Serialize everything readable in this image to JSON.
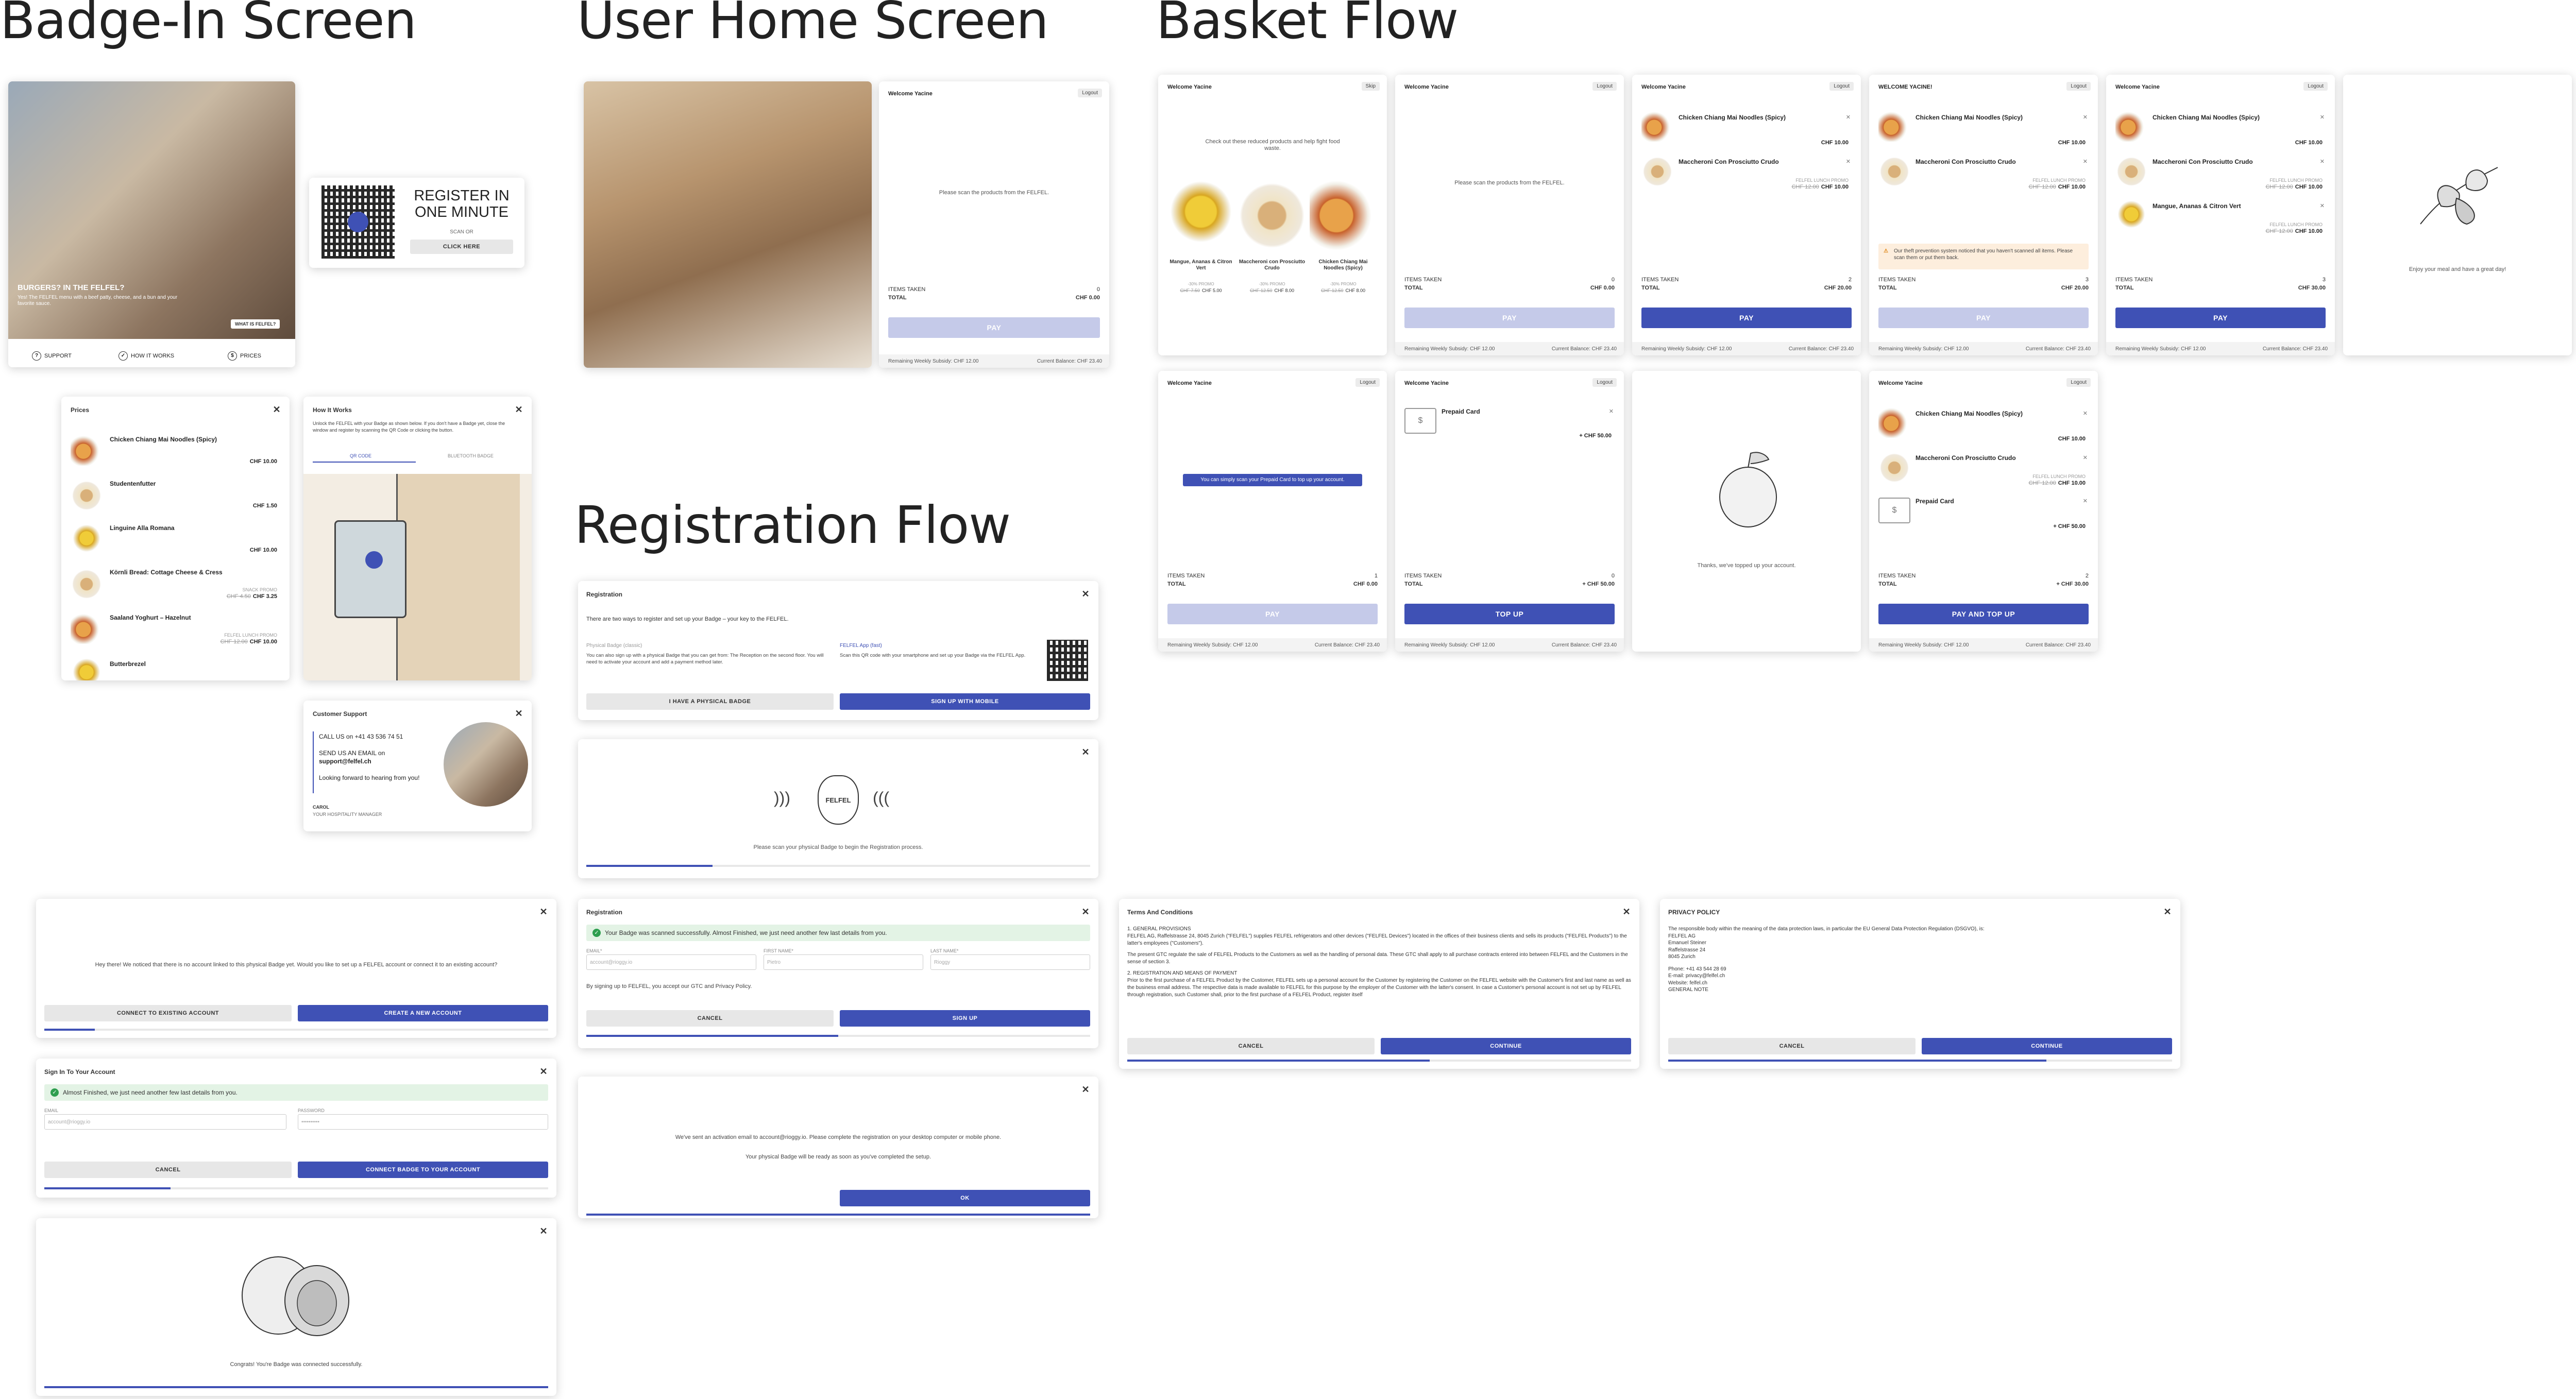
{
  "sections": {
    "badge_in": "Badge-In Screen",
    "user_home": "User Home Screen",
    "basket": "Basket Flow",
    "registration": "Registration Flow"
  },
  "badge_home": {
    "headline": "BURGERS? IN THE FELFEL?",
    "subline": "Yes! The FELFEL menu with a beef patty, cheese, and a bun and your favorite sauce.",
    "what_is": "WHAT IS FELFEL?",
    "nav": [
      "SUPPORT",
      "HOW IT WORKS",
      "PRICES"
    ]
  },
  "register_card": {
    "title": "REGISTER IN ONE MINUTE",
    "scan_or": "SCAN OR",
    "click_here": "CLICK HERE"
  },
  "prices": {
    "title": "Prices",
    "items": [
      {
        "name": "Chicken Chiang Mai Noodles (Spicy)",
        "price": "CHF 10.00"
      },
      {
        "name": "Studentenfutter",
        "price": "CHF 1.50"
      },
      {
        "name": "Linguine Alla Romana",
        "price": "CHF 10.00"
      },
      {
        "name": "Körnli Bread: Cottage Cheese & Cress",
        "promo": "SNACK PROMO",
        "old": "CHF 4.50",
        "price": "CHF 3.25"
      },
      {
        "name": "Saaland Yoghurt – Hazelnut",
        "promo": "FELFEL LUNCH PROMO",
        "old": "CHF 12.00",
        "price": "CHF 10.00"
      },
      {
        "name": "Butterbrezel"
      }
    ]
  },
  "how": {
    "title": "How It Works",
    "text": "Unlock the FELFEL with your Badge as shown below. If you don't have a Badge yet, close the window and register by scanning the QR Code or clicking the button.",
    "tabs": [
      "QR CODE",
      "BLUETOOTH BADGE"
    ]
  },
  "support": {
    "title": "Customer Support",
    "call": "CALL US on +41 43 536 74 51",
    "email_pre": "SEND US AN EMAIL on",
    "email": "support@felfel.ch",
    "note": "Looking forward to hearing from you!",
    "name": "CAROL",
    "role": "YOUR HOSPITALITY MANAGER"
  },
  "user_home": {
    "welcome": "Welcome Yacine",
    "logout": "Logout",
    "scan": "Please scan the products from the FELFEL.",
    "items_taken": "ITEMS TAKEN",
    "items_val": "0",
    "total": "TOTAL",
    "total_val": "CHF 0.00",
    "pay": "PAY",
    "subsidy": "Remaining Weekly Subsidy: CHF 12.00",
    "balance": "Current Balance: CHF 23.40"
  },
  "basket": {
    "b1": {
      "welcome": "Welcome Yacine",
      "skip": "Skip",
      "text": "Check out these reduced products and help fight food waste.",
      "products": [
        {
          "name": "Mangue, Ananas & Citron Vert",
          "tag": "-30% PROMO",
          "old": "CHF 7.50",
          "price": "CHF 5.00"
        },
        {
          "name": "Maccheroni con Prosciutto Crudo",
          "tag": "-30% PROMO",
          "old": "CHF 12.50",
          "price": "CHF 8.00"
        },
        {
          "name": "Chicken Chiang Mai Noodles (Spicy)",
          "tag": "-30% PROMO",
          "old": "CHF 12.50",
          "price": "CHF 8.00"
        }
      ]
    },
    "b2": {
      "welcome": "Welcome Yacine",
      "logout": "Logout",
      "scan": "Please scan the products from the FELFEL.",
      "items_taken": "ITEMS TAKEN",
      "items_val": "0",
      "total": "TOTAL",
      "total_val": "CHF 0.00",
      "pay": "PAY"
    },
    "b3": {
      "welcome": "Welcome Yacine",
      "logout": "Logout",
      "items": [
        {
          "name": "Chicken Chiang Mai Noodles (Spicy)",
          "price": "CHF 10.00"
        },
        {
          "name": "Maccheroni Con Prosciutto Crudo",
          "promo": "FELFEL LUNCH PROMO",
          "old": "CHF 12.00",
          "price": "CHF 10.00"
        }
      ],
      "items_taken": "ITEMS TAKEN",
      "items_val": "2",
      "total": "TOTAL",
      "total_val": "CHF 20.00",
      "pay": "PAY"
    },
    "b4": {
      "welcome": "WELCOME YACINE!",
      "logout": "Logout",
      "items": [
        {
          "name": "Chicken Chiang Mai Noodles (Spicy)",
          "price": "CHF 10.00"
        },
        {
          "name": "Maccheroni Con Prosciutto Crudo",
          "promo": "FELFEL LUNCH PROMO",
          "old": "CHF 12.00",
          "price": "CHF 10.00"
        }
      ],
      "warning": "Our theft prevention system noticed that you haven't scanned all items. Please scan them or put them back.",
      "items_taken": "ITEMS TAKEN",
      "items_val": "3",
      "total": "TOTAL",
      "total_val": "CHF 20.00",
      "pay": "PAY"
    },
    "b5": {
      "welcome": "Welcome Yacine",
      "logout": "Logout",
      "items": [
        {
          "name": "Chicken Chiang Mai Noodles (Spicy)",
          "price": "CHF 10.00"
        },
        {
          "name": "Maccheroni Con Prosciutto Crudo",
          "promo": "FELFEL LUNCH PROMO",
          "old": "CHF 12.00",
          "price": "CHF 10.00"
        },
        {
          "name": "Mangue, Ananas & Citron Vert",
          "promo": "FELFEL LUNCH PROMO",
          "old": "CHF 12.00",
          "price": "CHF 10.00"
        }
      ],
      "items_taken": "ITEMS TAKEN",
      "items_val": "3",
      "total": "TOTAL",
      "total_val": "CHF 30.00",
      "pay": "PAY"
    },
    "b6": {
      "text": "Enjoy your meal and have a great day!"
    },
    "b7": {
      "welcome": "Welcome Yacine",
      "logout": "Logout",
      "notice": "You can simply scan your Prepaid Card to top up your account.",
      "items_taken": "ITEMS TAKEN",
      "items_val": "1",
      "total": "TOTAL",
      "total_val": "CHF 0.00",
      "pay": "PAY"
    },
    "b8": {
      "welcome": "Welcome Yacine",
      "logout": "Logout",
      "card": "Prepaid Card",
      "amount": "+ CHF 50.00",
      "items_taken": "ITEMS TAKEN",
      "items_val": "0",
      "total": "TOTAL",
      "total_val": "+ CHF 50.00",
      "btn": "TOP UP"
    },
    "b9": {
      "text": "Thanks, we've topped up your account."
    },
    "b10": {
      "welcome": "Welcome Yacine",
      "logout": "Logout",
      "items": [
        {
          "name": "Chicken Chiang Mai Noodles (Spicy)",
          "price": "CHF 10.00"
        },
        {
          "name": "Maccheroni Con Prosciutto Crudo",
          "promo": "FELFEL LUNCH PROMO",
          "old": "CHF 12.00",
          "price": "CHF 10.00"
        }
      ],
      "card": "Prepaid Card",
      "amount": "+ CHF 50.00",
      "items_taken": "ITEMS TAKEN",
      "items_val": "2",
      "total": "TOTAL",
      "total_val": "+ CHF 30.00",
      "btn": "PAY AND TOP UP"
    },
    "subsidy": "Remaining Weekly Subsidy: CHF 12.00",
    "balance": "Current Balance: CHF 23.40"
  },
  "reg1": {
    "title": "Registration",
    "intro": "There are two ways to register and set up your Badge – your key to the FELFEL.",
    "col1_title": "Physical Badge (classic)",
    "col1_text": "You can also sign up with a physical Badge that you can get from: The Reception on the second floor. You will need to activate your account and add a payment method later.",
    "col2_title": "FELFEL App (fast)",
    "col2_text": "Scan this QR code with your smartphone and set up your Badge via the FELFEL App.",
    "btn1": "I HAVE A PHYSICAL BADGE",
    "btn2": "SIGN UP WITH MOBILE",
    "progress": 0
  },
  "reg2": {
    "badge": "FELFEL",
    "text": "Please scan your physical Badge to begin the Registration process.",
    "progress": 0.25
  },
  "reg3": {
    "title": "Registration",
    "ok": "Your Badge was scanned successfully. Almost Finished, we just need another few last details from you.",
    "email_l": "EMAIL*",
    "email_p": "account@rioggy.io",
    "first_l": "FIRST NAME*",
    "first_p": "Pietro",
    "last_l": "LAST NAME*",
    "last_p": "Rioggy",
    "terms": "By signing up to FELFEL, you accept our GTC and Privacy Policy.",
    "cancel": "CANCEL",
    "signup": "SIGN UP",
    "progress": 0.5
  },
  "reg4": {
    "text1": "We've sent an activation email to account@rioggy.io. Please complete the registration on your desktop computer or mobile phone.",
    "text2": "Your physical Badge will be ready as soon as you've completed the setup.",
    "ok": "OK",
    "progress": 1
  },
  "terms": {
    "title": "Terms And Conditions",
    "body": [
      "1. GENERAL PROVISIONS",
      "FELFEL AG, Raffelstrasse 24, 8045 Zurich (\"FELFEL\") supplies FELFEL refrigerators and other devices (\"FELFEL Devices\") located in the offices of their business clients and sells its products (\"FELFEL Products\") to the latter's employees (\"Customers\").",
      "The present GTC regulate the sale of FELFEL Products to the Customers as well as the handling of personal data. These GTC shall apply to all purchase contracts entered into between FELFEL and the Customers in the sense of section 3.",
      "2. REGISTRATION AND MEANS OF PAYMENT",
      "Prior to the first purchase of a FELFEL Product by the Customer, FELFEL sets up a personal account for the Customer by registering the Customer on the FELFEL website with the Customer's first and last name as well as the business email address. The respective data is made available to FELFEL for this purpose by the employer of the Customer with the latter's consent. In case a Customer's personal account is not set up by FELFEL through registration, such Customer shall, prior to the first purchase of a FELFEL Product, register itself"
    ],
    "cancel": "CANCEL",
    "continue": "CONTINUE",
    "progress": 0.6
  },
  "privacy": {
    "title": "PRIVACY POLICY",
    "body": [
      "The responsible body within the meaning of the data protection laws, in particular the EU General Data Protection Regulation (DSGVO), is:",
      "FELFEL AG",
      "Emanuel Steiner",
      "Raffelstrasse 24",
      "8045 Zurich",
      "",
      "Phone: +41 43 544 28 69",
      "E-mail: privacy@felfel.ch",
      "Website: felfel.ch",
      "GENERAL NOTE"
    ],
    "cancel": "CANCEL",
    "continue": "CONTINUE",
    "progress": 0.75
  },
  "link1": {
    "text": "Hey there! We noticed that there is no account linked to this physical Badge yet. Would you like to set up a FELFEL account or connect it to an existing account?",
    "btn1": "CONNECT TO EXISTING ACCOUNT",
    "btn2": "CREATE A NEW ACCOUNT",
    "progress": 0.1
  },
  "link2": {
    "title": "Sign In To Your Account",
    "ok": "Almost Finished, we just need another few last details from you.",
    "email_l": "EMAIL",
    "email_p": "account@rioggy.io",
    "pw_l": "PASSWORD",
    "pw_p": "••••••••••",
    "cancel": "CANCEL",
    "connect": "CONNECT BADGE TO YOUR ACCOUNT",
    "progress": 0.25
  },
  "link3": {
    "text": "Congrats! You're Badge was connected successfully.",
    "progress": 1
  },
  "colors": {
    "primary": "#3f51b5",
    "disabled": "#c5cae9",
    "success_bg": "#e3f3e5",
    "warn_bg": "#fdeedd"
  }
}
